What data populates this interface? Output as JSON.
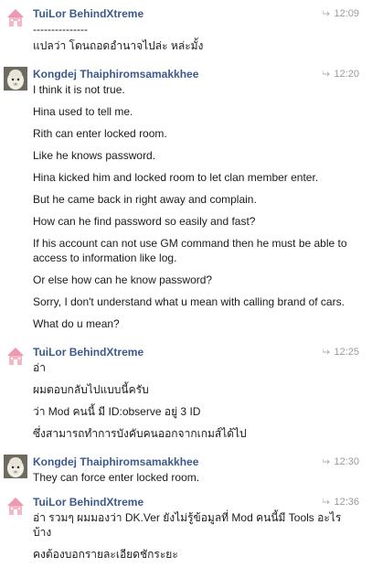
{
  "colors": {
    "sender": "#3b5a8c",
    "text": "#1a1a1a",
    "time": "#9a9a9a",
    "background": "#ffffff"
  },
  "messages": [
    {
      "sender": "TuiLor BehindXtreme",
      "time": "12:09",
      "avatar": "pink-house-avatar",
      "lines": [
        "---------------",
        "แปลว่า โดนถอดอำนาจไปล่ะ หล่ะมั้ง"
      ]
    },
    {
      "sender": "Kongdej Thaiphiromsamakkhee",
      "time": "12:20",
      "avatar": "alpaca-avatar",
      "lines": [
        "I think it is not true.",
        "Hina used to tell me.",
        "Rith can enter locked room.",
        "Like he knows password.",
        "Hina kicked him and locked room to let clan member enter.",
        "But he came back in right away and complain.",
        "How can he find password so easily and fast?",
        "If his account can not use GM command then he must be able to access to information like log.",
        "Or else how can he know password?",
        "Sorry, I don't understand what u mean with calling brand of cars.",
        "What do u mean?"
      ]
    },
    {
      "sender": "TuiLor BehindXtreme",
      "time": "12:25",
      "avatar": "pink-house-avatar",
      "lines": [
        "อ่า",
        "ผมตอบกลับไปแบบนี้ครับ",
        "ว่า Mod คนนี้ มี ID:observe อยู่ 3 ID",
        "ซึ่งสามารถทำการบังคับคนออกจากเกมส์ได้ไป"
      ]
    },
    {
      "sender": "Kongdej Thaiphiromsamakkhee",
      "time": "12:30",
      "avatar": "alpaca-avatar",
      "lines": [
        "They can force enter locked room."
      ]
    },
    {
      "sender": "TuiLor BehindXtreme",
      "time": "12:36",
      "avatar": "pink-house-avatar",
      "lines": [
        "อ่า รวมๆ ผมมองว่า DK.Ver ยังไม่รู้ข้อมูลที่ Mod คนนี้มี Tools อะไรบ้าง",
        "คงต้องบอกรายละเอียดชักระยะ"
      ]
    }
  ]
}
